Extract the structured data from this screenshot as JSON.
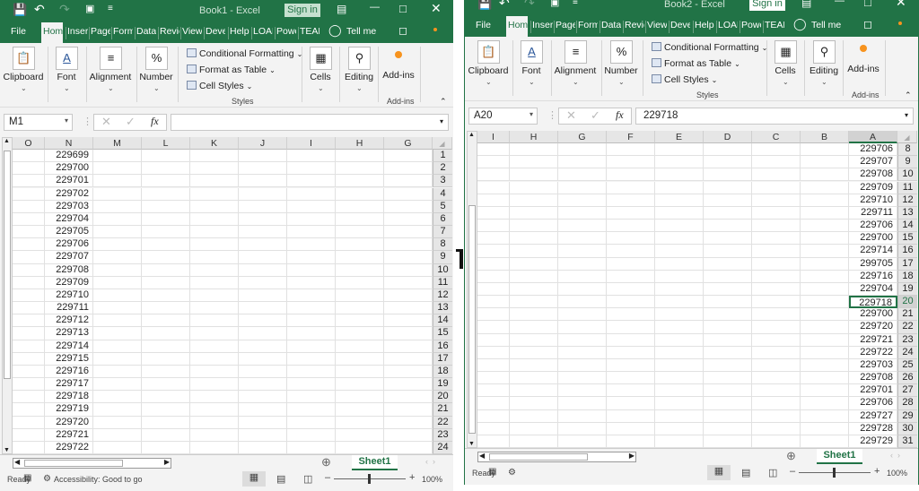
{
  "accent": "#217346",
  "windows": [
    {
      "id": "book1",
      "title": "Book1  -  Excel",
      "sign_in": "Sign in",
      "tabs": [
        "File",
        "Hom",
        "Inser",
        "Page",
        "Form",
        "Data",
        "Revie",
        "View",
        "Deve",
        "Help",
        "LOAD",
        "Powe",
        "TEAM"
      ],
      "tell_me": "Tell me",
      "ribbon": {
        "clipboard": "Clipboard",
        "font": "Font",
        "alignment": "Alignment",
        "number": "Number",
        "conditional_formatting": "Conditional Formatting",
        "format_as_table": "Format as Table",
        "cell_styles": "Cell Styles",
        "styles_group": "Styles",
        "cells": "Cells",
        "editing": "Editing",
        "addins": "Add-ins",
        "addins_group": "Add-ins"
      },
      "name_box": "M1",
      "formula": "",
      "columns": [
        "O",
        "N",
        "M",
        "L",
        "K",
        "J",
        "I",
        "H",
        "G"
      ],
      "value_column": "N",
      "rows": [
        1,
        2,
        3,
        4,
        5,
        6,
        7,
        8,
        9,
        10,
        11,
        12,
        13,
        14,
        15,
        16,
        17,
        18,
        19,
        20,
        21,
        22,
        23,
        24
      ],
      "values": [
        "229699",
        "229700",
        "229701",
        "229702",
        "229703",
        "229704",
        "229705",
        "229706",
        "229707",
        "229708",
        "229709",
        "229710",
        "229711",
        "229712",
        "229713",
        "229714",
        "229715",
        "229716",
        "229717",
        "229718",
        "229719",
        "229720",
        "229721",
        "229722"
      ],
      "selected_row": null,
      "sheet_tab": "Sheet1",
      "status": "Ready",
      "accessibility": "Accessibility: Good to go",
      "zoom": "100%"
    },
    {
      "id": "book2",
      "title": "Book2  -  Excel",
      "sign_in": "Sign in",
      "tabs": [
        "File",
        "Hom",
        "Inser",
        "Page",
        "Form",
        "Data",
        "Revie",
        "View",
        "Deve",
        "Help",
        "LOAD",
        "Powe",
        "TEAM"
      ],
      "tell_me": "Tell me",
      "ribbon": {
        "clipboard": "Clipboard",
        "font": "Font",
        "alignment": "Alignment",
        "number": "Number",
        "conditional_formatting": "Conditional Formatting",
        "format_as_table": "Format as Table",
        "cell_styles": "Cell Styles",
        "styles_group": "Styles",
        "cells": "Cells",
        "editing": "Editing",
        "addins": "Add-ins",
        "addins_group": "Add-ins"
      },
      "name_box": "A20",
      "formula": "229718",
      "columns": [
        "I",
        "H",
        "G",
        "F",
        "E",
        "D",
        "C",
        "B",
        "A"
      ],
      "value_column": "A",
      "rows": [
        8,
        9,
        10,
        11,
        12,
        13,
        14,
        15,
        16,
        17,
        18,
        19,
        20,
        21,
        22,
        23,
        24,
        25,
        26,
        27,
        28,
        29,
        30,
        31
      ],
      "values": [
        "229706",
        "229707",
        "229708",
        "229709",
        "229710",
        "229711",
        "229706",
        "229700",
        "229714",
        "299705",
        "229716",
        "229704",
        "229718",
        "229700",
        "229720",
        "229721",
        "229722",
        "229703",
        "229708",
        "229701",
        "229706",
        "229727",
        "229728",
        "229729"
      ],
      "selected_row": 20,
      "sheet_tab": "Sheet1",
      "status": "Ready",
      "accessibility": null,
      "zoom": "100%"
    }
  ]
}
